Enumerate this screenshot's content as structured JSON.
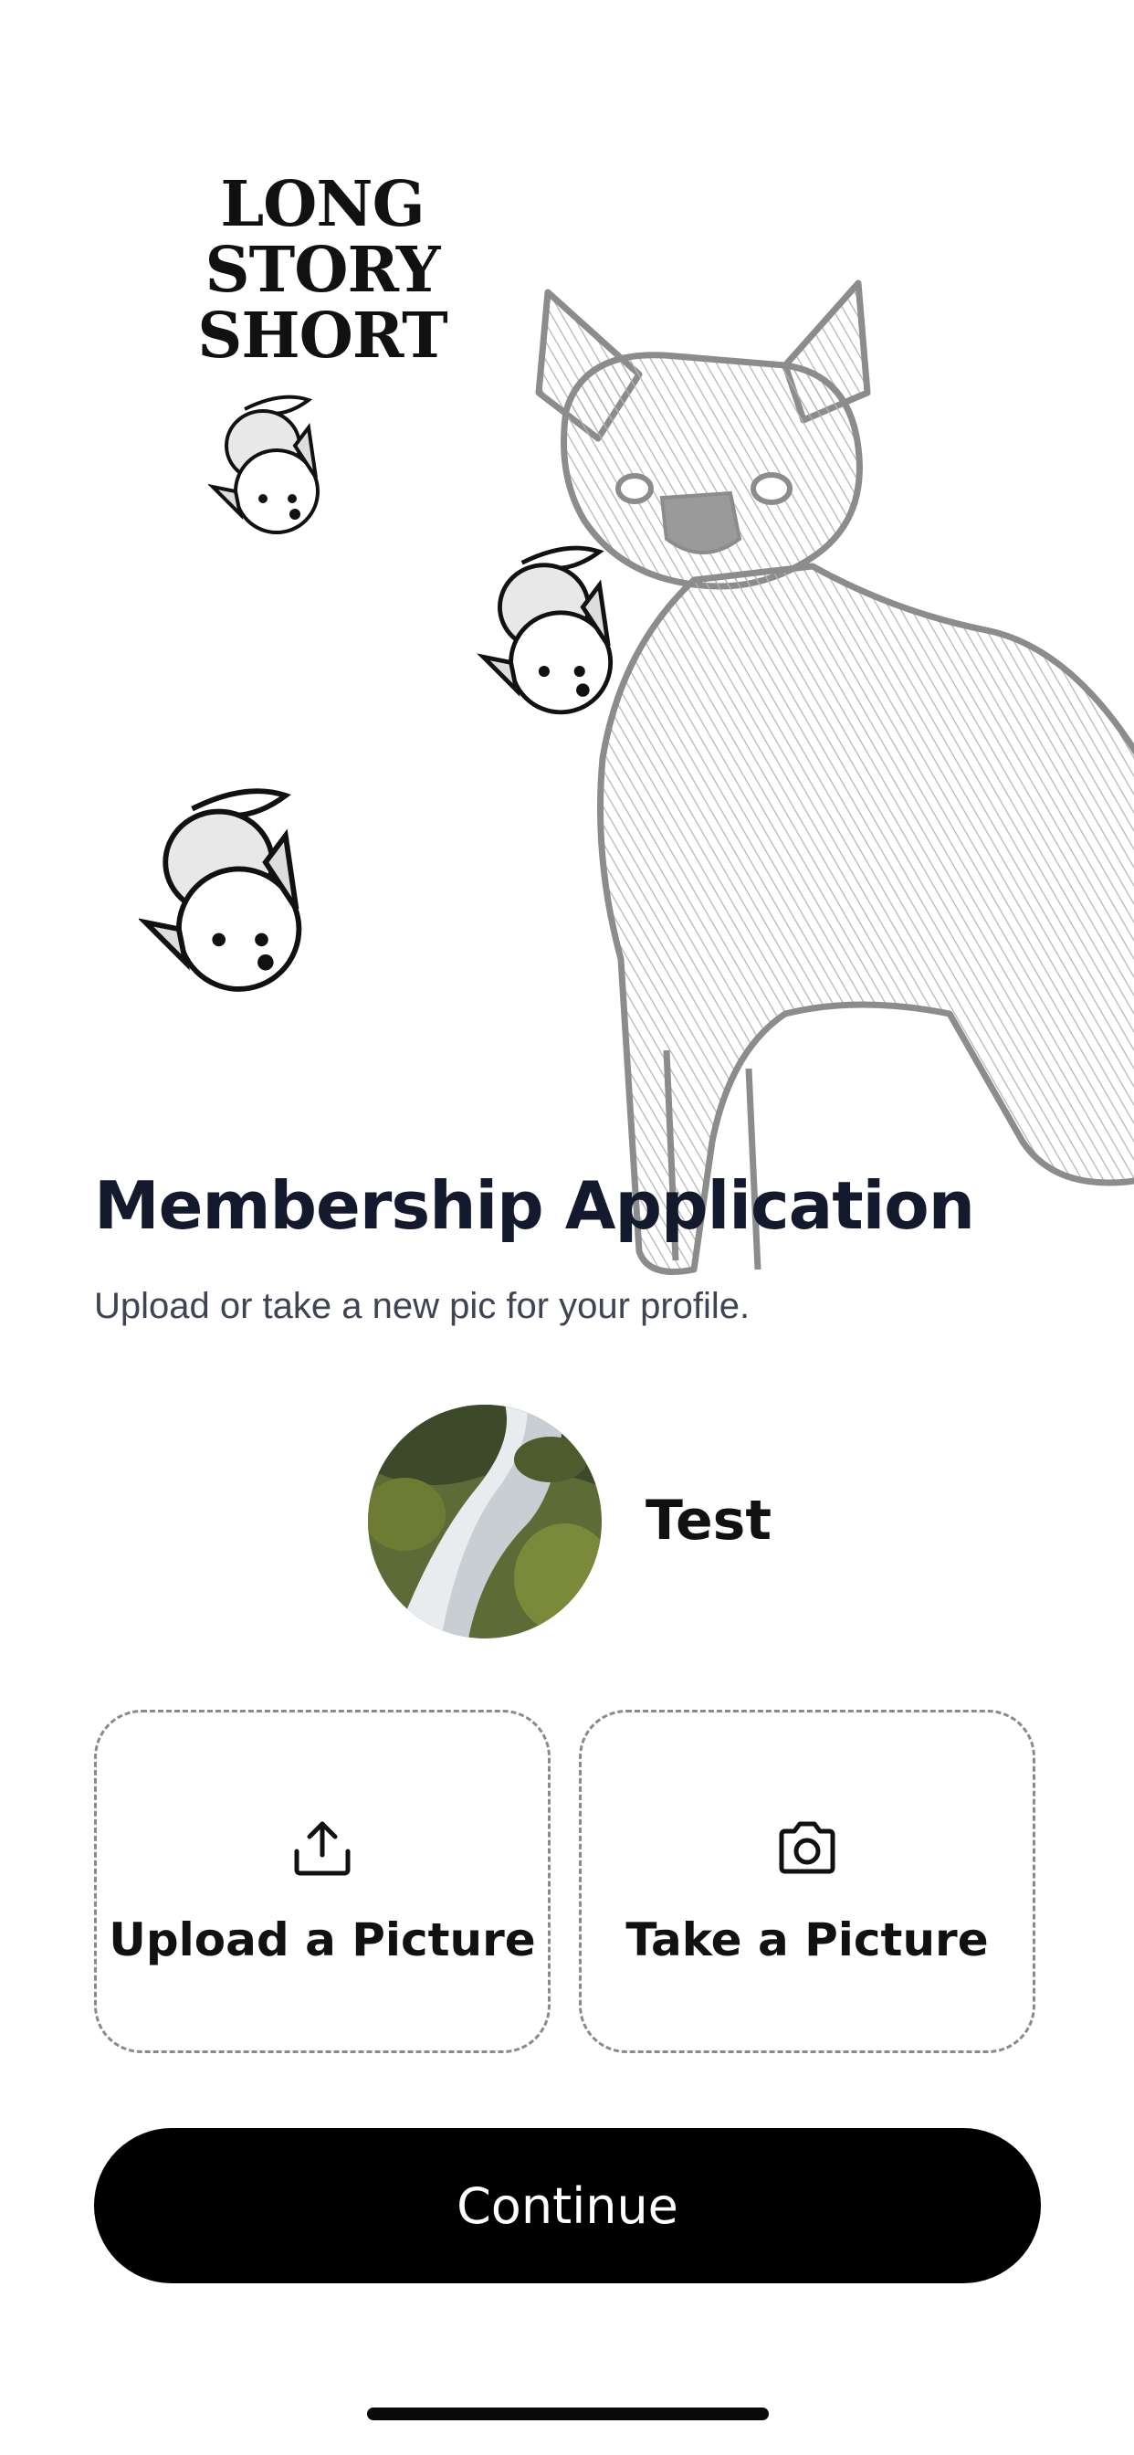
{
  "brand": {
    "logo_line1": "LONG STORY",
    "logo_line2": "SHORT"
  },
  "illustrations": {
    "large_dog": "chihuahua-illustration",
    "small_dogs": [
      "puppy-illustration",
      "puppy-illustration",
      "puppy-illustration"
    ]
  },
  "header": {
    "title": "Membership Application",
    "subtitle": "Upload or take a new pic for your profile."
  },
  "profile": {
    "name": "Test",
    "avatar": "waterfall-photo"
  },
  "actions": {
    "upload": {
      "label": "Upload a Picture",
      "icon": "upload-icon"
    },
    "camera": {
      "label": "Take a Picture",
      "icon": "camera-icon"
    }
  },
  "continue_button": {
    "label": "Continue"
  },
  "colors": {
    "title": "#141a2e",
    "button_bg": "#000000",
    "button_text": "#ffffff",
    "dashed_border": "#8a8a8a",
    "illustration_stroke": "#8c8c8c"
  }
}
